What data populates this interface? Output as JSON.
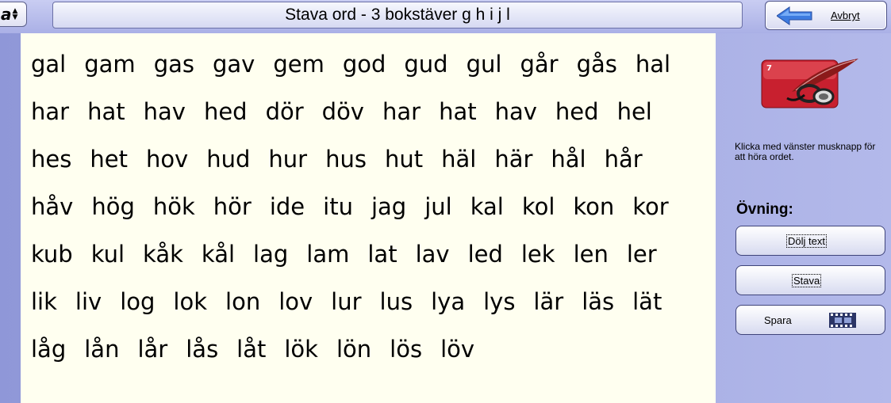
{
  "topbar": {
    "font_button_label": "a",
    "title": "Stava ord - 3 bokstäver g h i j l",
    "cancel_label": "Avbryt"
  },
  "words": {
    "rows": [
      [
        "gal",
        "gam",
        "gas",
        "gav",
        "gem",
        "god",
        "gud",
        "gul",
        "går",
        "gås",
        "hal"
      ],
      [
        "har",
        "hat",
        "hav",
        "hed",
        "dör",
        "döv",
        "har",
        "hat",
        "hav",
        "hed",
        "hel"
      ],
      [
        "hes",
        "het",
        "hov",
        "hud",
        "hur",
        "hus",
        "hut",
        "häl",
        "här",
        "hål",
        "hår"
      ],
      [
        "håv",
        "hög",
        "hök",
        "hör",
        "ide",
        "itu",
        "jag",
        "jul",
        "kal",
        "kol",
        "kon",
        "kor"
      ],
      [
        "kub",
        "kul",
        "kåk",
        "kål",
        "lag",
        "lam",
        "lat",
        "lav",
        "led",
        "lek",
        "len",
        "ler"
      ],
      [
        "lik",
        "liv",
        "log",
        "lok",
        "lon",
        "lov",
        "lur",
        "lus",
        "lya",
        "lys",
        "lär",
        "läs",
        "lät"
      ],
      [
        "låg",
        "lån",
        "lår",
        "lås",
        "låt",
        "lök",
        "lön",
        "lös",
        "löv"
      ]
    ]
  },
  "sidebar": {
    "instruction": "Klicka med vänster musknapp för att höra ordet.",
    "exercise_label": "Övning:",
    "hide_text_label": "Dölj text",
    "spell_label": "Stava",
    "save_label": "Spara"
  },
  "colors": {
    "background": "#a3aae2",
    "word_panel": "#fffff0",
    "logo_red": "#c8202f"
  }
}
